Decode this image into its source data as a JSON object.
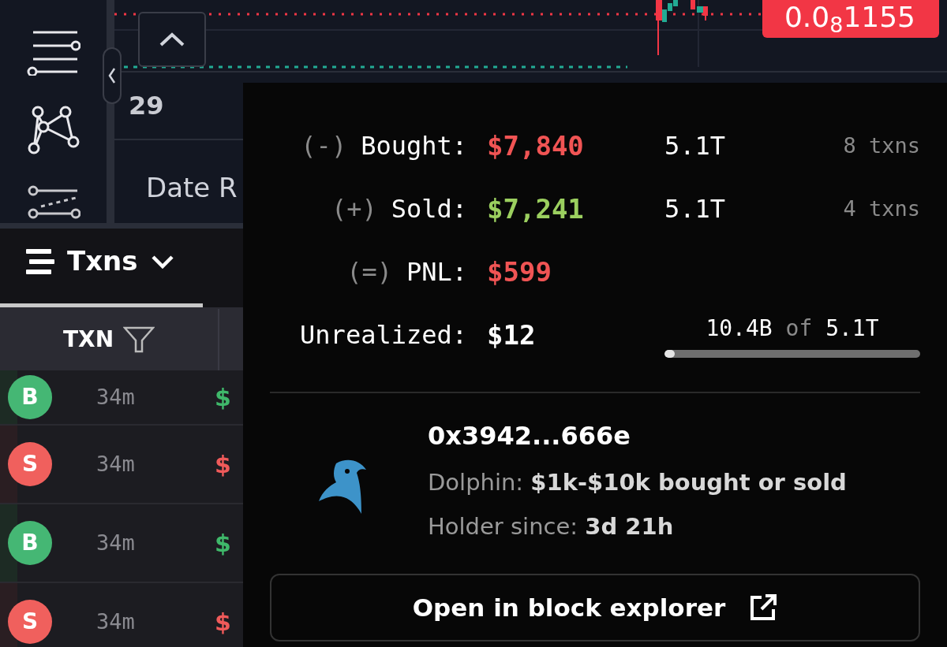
{
  "chart": {
    "price_label": "0.0$_{8}$1155"
  },
  "stats_strip": {
    "value": "29",
    "label": "Date R"
  },
  "txns_panel": {
    "tab": {
      "label": "Txns",
      "selected": true
    },
    "column": {
      "label": "TXN"
    },
    "rows": [
      {
        "kind": "buy",
        "side": "B",
        "age": "34m",
        "amount": "$"
      },
      {
        "kind": "sell",
        "side": "S",
        "age": "34m",
        "amount": "$"
      },
      {
        "kind": "buy",
        "side": "B",
        "age": "34m",
        "amount": "$"
      },
      {
        "kind": "sell",
        "side": "S",
        "age": "34m",
        "amount": "$"
      }
    ]
  },
  "popover": {
    "rows": [
      {
        "sign": "(-)",
        "label": "Bought:",
        "amount": "$7,840",
        "kind": "loss",
        "tokens": "5.1T",
        "txns": "8 txns"
      },
      {
        "sign": "(+)",
        "label": "Sold:",
        "amount": "$7,241",
        "kind": "profit",
        "tokens": "5.1T",
        "txns": "4 txns"
      },
      {
        "sign": "(=)",
        "label": "PNL:",
        "amount": "$599",
        "kind": "loss"
      }
    ],
    "unrealized": {
      "label": "Unrealized:",
      "value": "$12",
      "held": "10.4B",
      "of": "of",
      "total": "5.1T",
      "level": 0.04
    },
    "wallet": {
      "address": "0x3942...666e",
      "tier_text": "Dolphin: **$1k-$10k bought or sold**",
      "since_text": "Holder since: **3d 21h**"
    },
    "button": "Open in block explorer"
  }
}
